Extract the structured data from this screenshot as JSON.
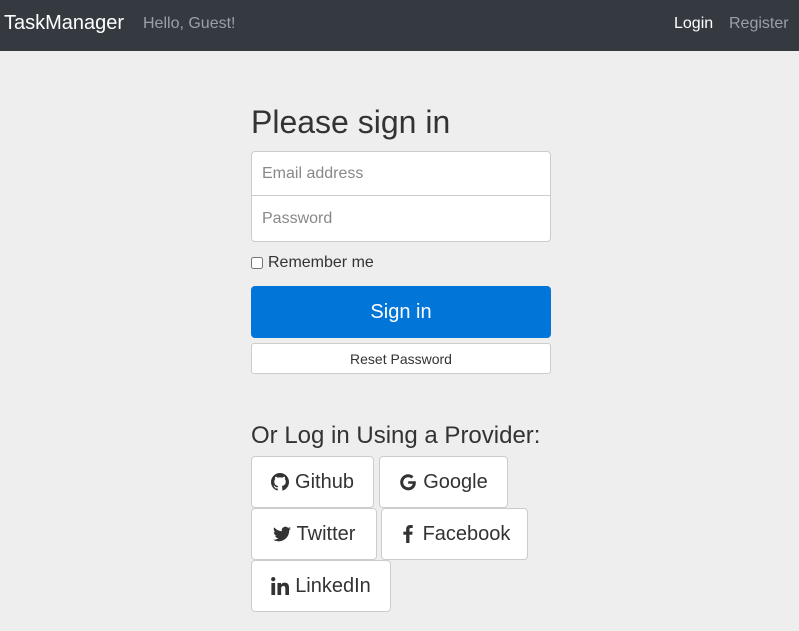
{
  "nav": {
    "brand": "TaskManager",
    "greeting": "Hello, Guest!",
    "login": "Login",
    "register": "Register"
  },
  "form": {
    "heading": "Please sign in",
    "email_placeholder": "Email address",
    "email_value": "",
    "password_placeholder": "Password",
    "password_value": "",
    "remember_label": "Remember me",
    "signin_label": "Sign in",
    "reset_label": "Reset Password"
  },
  "providers": {
    "title": "Or Log in Using a Provider:",
    "items": [
      {
        "label": "Github",
        "icon": "github-icon"
      },
      {
        "label": "Google",
        "icon": "google-icon"
      },
      {
        "label": "Twitter",
        "icon": "twitter-icon"
      },
      {
        "label": "Facebook",
        "icon": "facebook-icon"
      },
      {
        "label": "LinkedIn",
        "icon": "linkedin-icon"
      }
    ]
  },
  "colors": {
    "navbar_bg": "#343a40",
    "primary": "#0275d8",
    "page_bg": "#eeeeee"
  }
}
